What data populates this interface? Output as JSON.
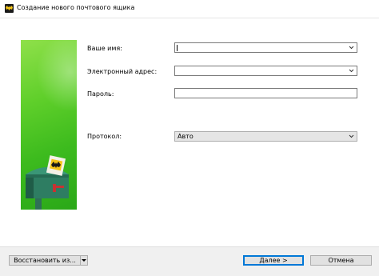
{
  "window": {
    "title": "Создание нового почтового ящика"
  },
  "form": {
    "name_label": "Ваше имя:",
    "name_value": "",
    "email_label": "Электронный адрес:",
    "email_value": "",
    "password_label": "Пароль:",
    "password_value": "",
    "protocol_label": "Протокол:",
    "protocol_value": "Авто"
  },
  "buttons": {
    "restore": "Восстановить из...",
    "next": "Далее >",
    "cancel": "Отмена"
  },
  "icons": {
    "app": "bat-icon",
    "dropdown": "chevron-down-icon",
    "banner": "mailbox-illustration"
  },
  "colors": {
    "banner_green": "#4cc424",
    "accent": "#0078d7"
  }
}
